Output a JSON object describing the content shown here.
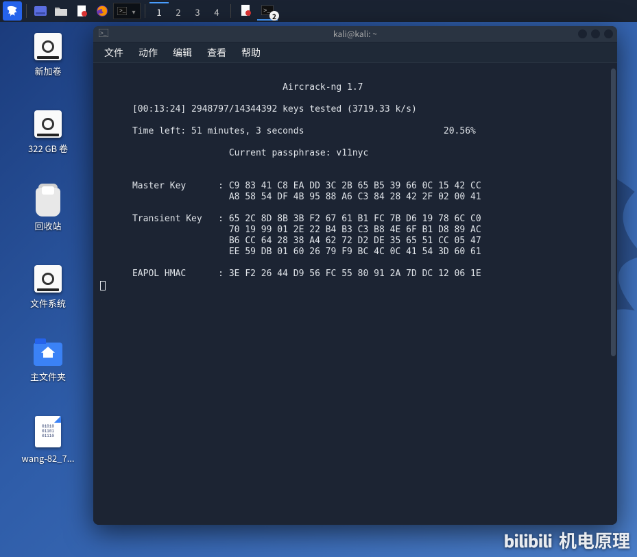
{
  "panel": {
    "workspaces": [
      "1",
      "2",
      "3",
      "4"
    ],
    "active_workspace": 0,
    "task_badge": "2"
  },
  "desktop": {
    "icons": [
      {
        "kind": "drive",
        "label": "新加卷"
      },
      {
        "kind": "drive",
        "label": "322 GB 卷"
      },
      {
        "kind": "trash",
        "label": "回收站"
      },
      {
        "kind": "drive",
        "label": "文件系统"
      },
      {
        "kind": "home",
        "label": "主文件夹"
      },
      {
        "kind": "text",
        "label": "wang-82_7..."
      }
    ]
  },
  "window": {
    "title": "kali@kali: ~",
    "menus": [
      "文件",
      "动作",
      "编辑",
      "查看",
      "帮助"
    ]
  },
  "term": {
    "app_title": "Aircrack-ng 1.7",
    "status_line": "[00:13:24] 2948797/14344392 keys tested (3719.33 k/s)",
    "time_left_label": "Time left: 51 minutes, 3 seconds",
    "percent": "20.56%",
    "passphrase_label": "Current passphrase: v11nyc",
    "master_key_label": "Master Key",
    "master_key_rows": [
      "C9 83 41 C8 EA DD 3C 2B 65 B5 39 66 0C 15 42 CC",
      "A8 58 54 DF 4B 95 88 A6 C3 84 28 42 2F 02 00 41"
    ],
    "transient_key_label": "Transient Key",
    "transient_key_rows": [
      "65 2C 8D 8B 3B F2 67 61 B1 FC 7B D6 19 78 6C C0",
      "70 19 99 01 2E 22 B4 B3 C3 B8 4E 6F B1 D8 89 AC",
      "B6 CC 64 28 38 A4 62 72 D2 DE 35 65 51 CC 05 47",
      "EE 59 DB 01 60 26 79 F9 BC 4C 0C 41 54 3D 60 61"
    ],
    "eapol_label": "EAPOL HMAC",
    "eapol_row": "3E F2 26 44 D9 56 FC 55 80 91 2A 7D DC 12 06 1E"
  },
  "watermark": {
    "brand": "bilibili",
    "channel": "机电原理"
  }
}
